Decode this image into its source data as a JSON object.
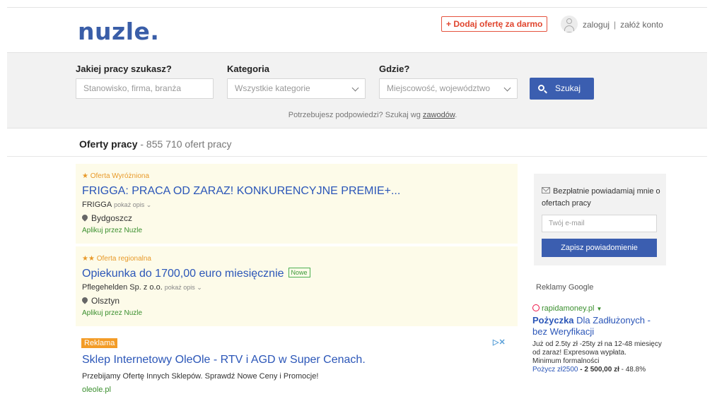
{
  "header": {
    "logo": "nuzle.",
    "add_offer": "+ Dodaj ofertę za darmo",
    "login": "zaloguj",
    "separator": "|",
    "register": "załóż konto"
  },
  "search": {
    "job_label": "Jakiej pracy szukasz?",
    "job_placeholder": "Stanowisko, firma, branża",
    "category_label": "Kategoria",
    "category_value": "Wszystkie kategorie",
    "where_label": "Gdzie?",
    "where_placeholder": "Miejscowość, województwo",
    "button_label": "Szukaj",
    "hint_text": "Potrzebujesz podpowiedzi? Szukaj wg ",
    "hint_link": "zawodów",
    "hint_dot": "."
  },
  "offers": {
    "heading": "Oferty pracy",
    "count": " - 855 710 ofert pracy",
    "items": [
      {
        "tag": "★ Oferta Wyróżniona",
        "title": "FRIGGA: PRACA OD ZARAZ! KONKURENCYJNE PREMIE+...",
        "company": "FRIGGA",
        "more": "pokaż opis ⌄",
        "location": "Bydgoszcz",
        "apply": "Aplikuj przez Nuzle"
      },
      {
        "tag": "★★ Oferta regionalna",
        "title": "Opiekunka do 1700,00 euro miesięcznie",
        "badge": "Nowe",
        "company": "Pflegehelden Sp. z o.o.",
        "more": "pokaż opis ⌄",
        "location": "Olsztyn",
        "apply": "Aplikuj przez Nuzle"
      }
    ]
  },
  "ad": {
    "badge": "Reklama",
    "choices": "▷✕",
    "title": "Sklep Internetowy OleOle - RTV i AGD w Super Cenach.",
    "description": "Przebijamy Ofertę Innych Sklepów. Sprawdź Nowe Ceny i Promocje!",
    "url": "oleole.pl"
  },
  "sidebar": {
    "notify_text": "Bezpłatnie powiadamiaj mnie o ofertach pracy",
    "email_placeholder": "Twój e-mail",
    "submit": "Zapisz powiadomienie",
    "google_ads_label": "Reklamy Google",
    "google_ad": {
      "source": "rapidamoney.pl",
      "source_arrow": "▼",
      "title_bold": "Pożyczka",
      "title_rest": " Dla Zadłużonych - bez Weryfikacji",
      "desc": "Już od 2.5ty zł -25ty zł na 12-48 miesięcy od zaraz! Expresowa wypłata.",
      "line2": "Minimum formalności",
      "price_link": "Pożycz zł2500",
      "price_rest": " - 2 500,00 zł",
      "price_pct": " - 48.8%"
    }
  }
}
